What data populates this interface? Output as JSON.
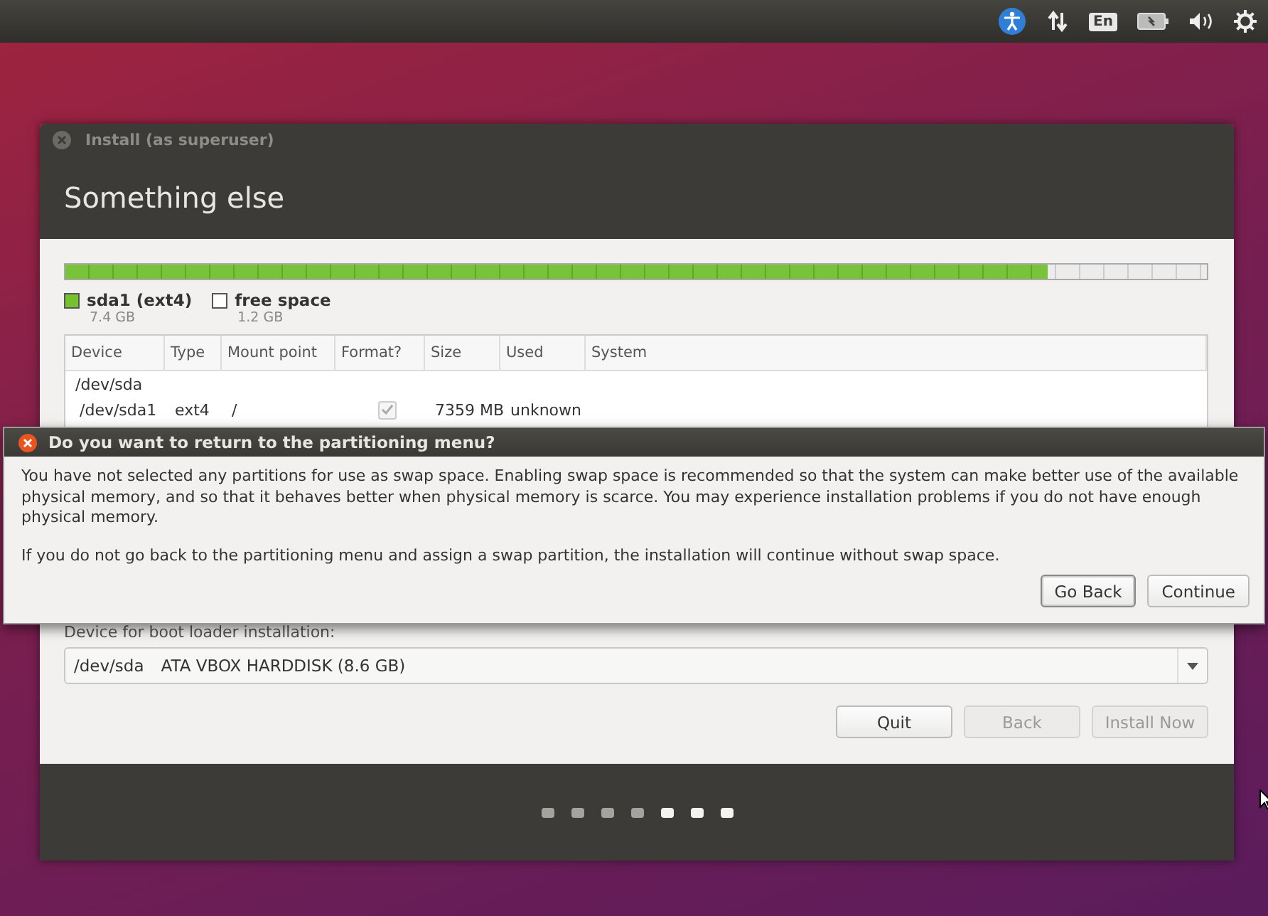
{
  "top_bar": {
    "keyboard_layout": "En"
  },
  "window": {
    "title": "Install (as superuser)",
    "heading": "Something else"
  },
  "partition_bar": {
    "level": 0.86
  },
  "legend": [
    {
      "name": "sda1 (ext4)",
      "size": "7.4 GB",
      "color": "#73c22e"
    },
    {
      "name": "free space",
      "size": "1.2 GB",
      "color": "#ffffff"
    }
  ],
  "table": {
    "columns": [
      "Device",
      "Type",
      "Mount point",
      "Format?",
      "Size",
      "Used",
      "System"
    ],
    "rows": [
      {
        "kind": "disk",
        "device": "/dev/sda"
      },
      {
        "kind": "partition",
        "device": "/dev/sda1",
        "type": "ext4",
        "mount": "/",
        "format": true,
        "size": "7359 MB",
        "used": "unknown"
      }
    ]
  },
  "boot_loader": {
    "label": "Device for boot loader installation:",
    "device": "/dev/sda",
    "description": "ATA VBOX HARDDISK (8.6 GB)"
  },
  "buttons": [
    {
      "label": "Quit",
      "disabled": false
    },
    {
      "label": "Back",
      "disabled": true
    },
    {
      "label": "Install Now",
      "disabled": true
    }
  ],
  "progress_dots": [
    {
      "active": false
    },
    {
      "active": false
    },
    {
      "active": false
    },
    {
      "active": false
    },
    {
      "active": true
    },
    {
      "active": true
    },
    {
      "active": true
    }
  ],
  "dialog": {
    "title": "Do you want to return to the partitioning menu?",
    "paragraphs": [
      "You have not selected any partitions for use as swap space. Enabling swap space is recommended so that the system can make better use of the available physical memory, and so that it behaves better when physical memory is scarce. You may experience installation problems if you do not have enough physical memory.",
      "If you do not go back to the partitioning menu and assign a swap partition, the installation will continue without swap space."
    ],
    "buttons": [
      {
        "label": "Go Back",
        "selected": true
      },
      {
        "label": "Continue",
        "selected": false
      }
    ]
  }
}
